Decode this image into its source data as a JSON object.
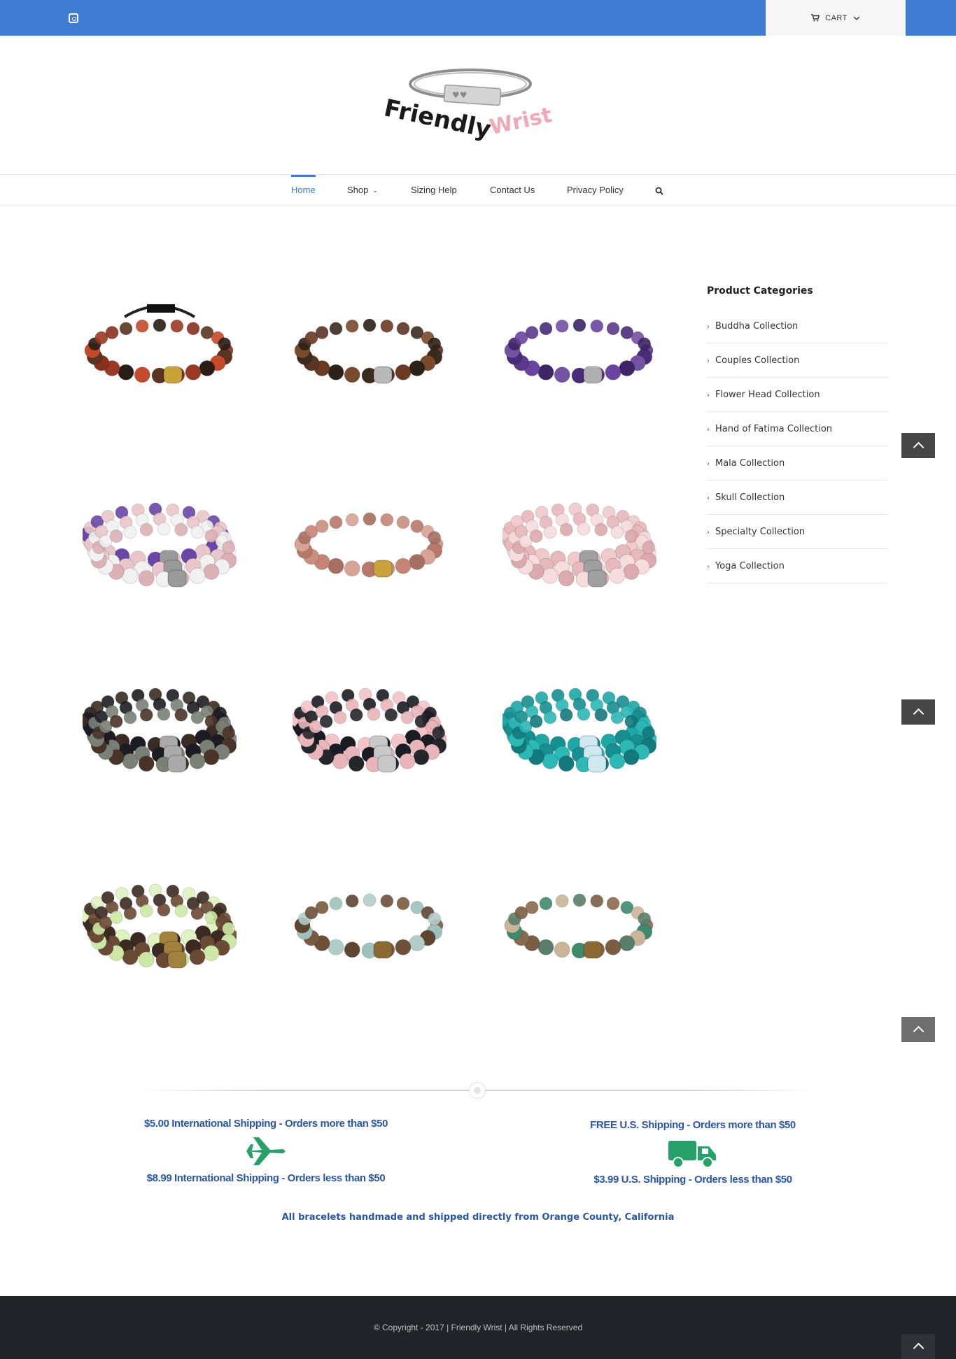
{
  "topbar": {
    "social_icon": "instagram-icon",
    "cart_label": "CART",
    "colors": {
      "bar": "#3d7bd4"
    }
  },
  "logo": {
    "word1": "Friendly",
    "word2": "Wrist"
  },
  "nav": {
    "items": [
      {
        "label": "Home",
        "active": true
      },
      {
        "label": "Shop",
        "has_dropdown": true
      },
      {
        "label": "Sizing Help"
      },
      {
        "label": "Contact Us"
      },
      {
        "label": "Privacy Policy"
      }
    ],
    "search_icon": "search-icon"
  },
  "products": [
    {
      "beads": [
        "#8b2f1e",
        "#5a3422",
        "#c44a2a",
        "#2a1c16",
        "#9a3a24"
      ],
      "charm": "#c9a23c",
      "style": "adjustable"
    },
    {
      "beads": [
        "#5a3424",
        "#3b2a1e",
        "#7a4a2c",
        "#2d221a",
        "#6a3a22"
      ],
      "charm": "#b8b8b8",
      "style": "single"
    },
    {
      "beads": [
        "#5b3a8c",
        "#4a2c78",
        "#7352a4",
        "#3d2466",
        "#6a44a0"
      ],
      "charm": "#b0b0b0",
      "style": "single"
    },
    {
      "beads": [
        "#6a47a6",
        "#e9c6c9",
        "#f1f1f1",
        "#dcb1b6",
        "#5b3a8c"
      ],
      "charm": "#9a9a9a",
      "style": "stack"
    },
    {
      "beads": [
        "#c98f7f",
        "#b8786a",
        "#d8a395",
        "#a66f62",
        "#c48576"
      ],
      "charm": "#c9a23c",
      "style": "single"
    },
    {
      "beads": [
        "#f0c9cb",
        "#e7b8bc",
        "#f6dcdd",
        "#dca9ae",
        "#ecc0c3"
      ],
      "charm": "#a0a0a0",
      "style": "stack"
    },
    {
      "beads": [
        "#3a2c24",
        "#1c1c22",
        "#7a8076",
        "#4a342a",
        "#262a30"
      ],
      "charm": "#aaaaaa",
      "style": "stack"
    },
    {
      "beads": [
        "#f2c4c8",
        "#1a1c22",
        "#e8b5ba",
        "#24262c",
        "#f5d0d3"
      ],
      "charm": "#c8c8c8",
      "style": "stack"
    },
    {
      "beads": [
        "#1fa6a6",
        "#178e90",
        "#2cb8b5",
        "#13797c",
        "#21a0a2"
      ],
      "charm": "#cfe8f0",
      "style": "stack"
    },
    {
      "beads": [
        "#dff3c0",
        "#3a2a22",
        "#6a4a34",
        "#cde8a6",
        "#2a201c"
      ],
      "charm": "#a0823c",
      "style": "stack"
    },
    {
      "beads": [
        "#7a5a3e",
        "#9ec1bd",
        "#5e4532",
        "#b3cdc9",
        "#6d503a"
      ],
      "charm": "#8a6a32",
      "style": "single"
    },
    {
      "beads": [
        "#8a6a4c",
        "#3e8a6e",
        "#c9b69a",
        "#5a7e6a",
        "#7a5e44"
      ],
      "charm": "#8a6a32",
      "style": "single"
    }
  ],
  "sidebar": {
    "title": "Product Categories",
    "items": [
      "Buddha Collection",
      "Couples Collection",
      "Flower Head Collection",
      "Hand of Fatima Collection",
      "Mala Collection",
      "Skull Collection",
      "Specialty Collection",
      "Yoga Collection"
    ]
  },
  "shipping": {
    "international": {
      "line1": "$5.00 International Shipping - Orders more than $50",
      "line2": "$8.99 International Shipping - Orders less than $50",
      "icon": "airplane-icon"
    },
    "domestic": {
      "line1": "FREE U.S. Shipping - Orders more than $50",
      "line2": "$3.99 U.S. Shipping - Orders less than $50",
      "icon": "truck-icon"
    },
    "icon_color": "#27a06a"
  },
  "tagline": "All bracelets handmade and shipped directly from Orange County, California",
  "footer": {
    "copyright": "© Copyright - 2017 | Friendly Wrist | All Rights Reserved"
  }
}
